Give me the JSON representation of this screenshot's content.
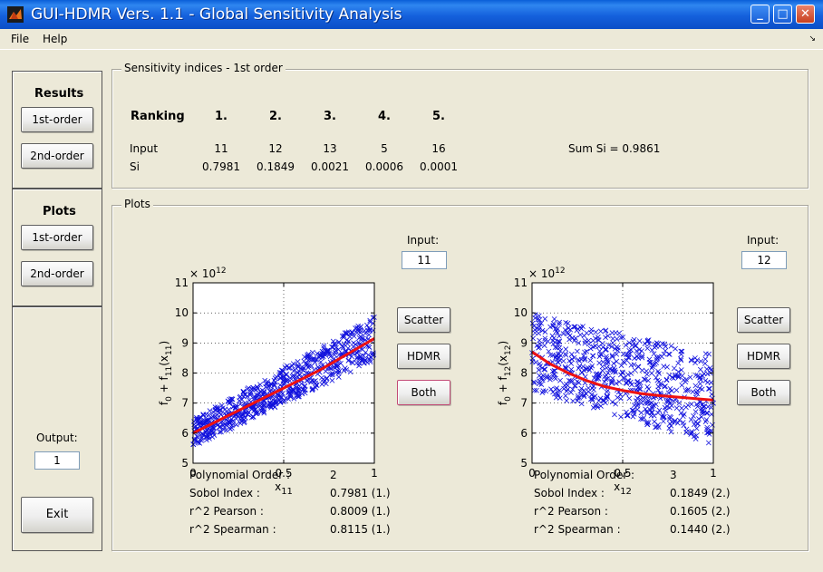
{
  "window": {
    "title": "GUI-HDMR Vers. 1.1 - Global Sensitivity Analysis",
    "min_label": "_",
    "max_label": "□",
    "close_label": "✕"
  },
  "menu": {
    "items": [
      "File",
      "Help"
    ]
  },
  "results": {
    "heading": "Results",
    "first_order": "1st-order",
    "second_order": "2nd-order"
  },
  "plots_side": {
    "heading": "Plots",
    "first_order": "1st-order",
    "second_order": "2nd-order"
  },
  "output": {
    "label": "Output:",
    "value": "1"
  },
  "exit_label": "Exit",
  "sensitivity": {
    "title": "Sensitivity indices - 1st order",
    "ranking_label": "Ranking",
    "input_label": "Input",
    "si_label": "Si",
    "ranks": [
      "1.",
      "2.",
      "3.",
      "4.",
      "5."
    ],
    "inputs": [
      "11",
      "12",
      "13",
      "5",
      "16"
    ],
    "si_values": [
      "0.7981",
      "0.1849",
      "0.0021",
      "0.0006",
      "0.0001"
    ],
    "sum_text": "Sum Si = 0.9861"
  },
  "plots_frame": {
    "title": "Plots"
  },
  "plot1": {
    "input_label": "Input:",
    "input_value": "11",
    "scatter_label": "Scatter",
    "hdmr_label": "HDMR",
    "both_label": "Both",
    "stats": {
      "labels": [
        "Polynomial Order :",
        "Sobol Index :",
        "r^2 Pearson :",
        "r^2 Spearman :"
      ],
      "values": [
        "2",
        "0.7981 (1.)",
        "0.8009 (1.)",
        "0.8115 (1.)"
      ]
    }
  },
  "plot2": {
    "input_label": "Input:",
    "input_value": "12",
    "scatter_label": "Scatter",
    "hdmr_label": "HDMR",
    "both_label": "Both",
    "stats": {
      "labels": [
        "Polynomial Order :",
        "Sobol Index :",
        "r^2 Pearson :",
        "r^2 Spearman :"
      ],
      "values": [
        "3",
        "0.1849 (2.)",
        "0.1605 (2.)",
        "0.1440 (2.)"
      ]
    }
  },
  "chart_data": [
    {
      "type": "scatter",
      "title": "",
      "xlabel": "x_11",
      "ylabel": "f_0 + f_11(x_11)",
      "y_exponent_label": "× 10^12",
      "xlim": [
        0,
        1
      ],
      "ylim": [
        5,
        11
      ],
      "xticks": [
        "0",
        "0.5",
        "1"
      ],
      "yticks": [
        "5",
        "6",
        "7",
        "8",
        "9",
        "10",
        "11"
      ],
      "grid": true,
      "scatter_color": "#1010dd",
      "curve_color": "#ee1111",
      "series": [
        {
          "kind": "hdmr-curve",
          "x": [
            0,
            0.1,
            0.2,
            0.3,
            0.4,
            0.5,
            0.6,
            0.7,
            0.8,
            0.9,
            1.0
          ],
          "y": [
            6.0,
            6.3,
            6.6,
            6.9,
            7.2,
            7.5,
            7.8,
            8.1,
            8.45,
            8.8,
            9.15
          ]
        },
        {
          "kind": "scatter-band",
          "x": [
            0,
            1
          ],
          "center": [
            6.0,
            9.15
          ],
          "halfwidth": [
            0.45,
            0.75
          ]
        }
      ]
    },
    {
      "type": "scatter",
      "title": "",
      "xlabel": "x_12",
      "ylabel": "f_0 + f_12(x_12)",
      "y_exponent_label": "× 10^12",
      "xlim": [
        0,
        1
      ],
      "ylim": [
        5,
        11
      ],
      "xticks": [
        "0",
        "0.5",
        "1"
      ],
      "yticks": [
        "5",
        "6",
        "7",
        "8",
        "9",
        "10",
        "11"
      ],
      "grid": true,
      "scatter_color": "#1010dd",
      "curve_color": "#ee1111",
      "series": [
        {
          "kind": "hdmr-curve",
          "x": [
            0,
            0.1,
            0.2,
            0.3,
            0.4,
            0.5,
            0.6,
            0.7,
            0.8,
            0.9,
            1.0
          ],
          "y": [
            8.7,
            8.3,
            8.0,
            7.75,
            7.55,
            7.42,
            7.32,
            7.25,
            7.2,
            7.15,
            7.1
          ]
        },
        {
          "kind": "scatter-band",
          "x": [
            0,
            1
          ],
          "center": [
            8.7,
            7.1
          ],
          "halfwidth": [
            1.3,
            1.5
          ]
        }
      ]
    }
  ]
}
